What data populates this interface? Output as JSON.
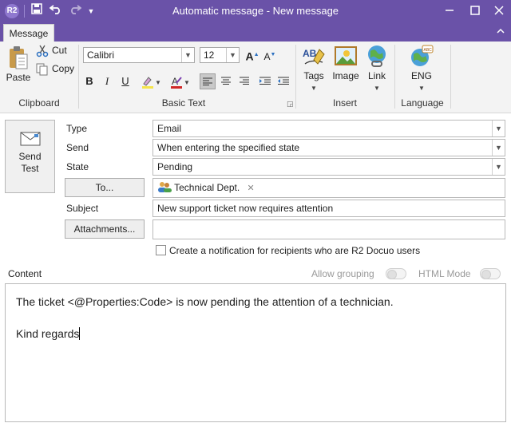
{
  "window": {
    "title": "Automatic message - New message",
    "app_icon": "R2"
  },
  "ribbon": {
    "tab": "Message",
    "clipboard": {
      "paste": "Paste",
      "cut": "Cut",
      "copy": "Copy",
      "label": "Clipboard"
    },
    "basic_text": {
      "font": "Calibri",
      "size": "12",
      "grow": "A",
      "shrink": "A",
      "bold": "B",
      "italic": "I",
      "underline": "U",
      "label": "Basic Text"
    },
    "insert": {
      "tags": "Tags",
      "image": "Image",
      "link": "Link",
      "label": "Insert"
    },
    "language": {
      "lang": "ENG",
      "label": "Language"
    }
  },
  "form": {
    "send_test": "Send\nTest",
    "type_label": "Type",
    "type_value": "Email",
    "send_label": "Send",
    "send_value": "When entering the specified state",
    "state_label": "State",
    "state_value": "Pending",
    "to_button": "To...",
    "recipient": "Technical Dept.",
    "subject_label": "Subject",
    "subject_value": "New support ticket now requires attention",
    "attachments_button": "Attachments...",
    "notify_label": "Create a notification for recipients who are R2 Docuo users",
    "content_label": "Content",
    "allow_grouping": "Allow grouping",
    "html_mode": "HTML Mode"
  },
  "content": {
    "line1": "The ticket <@Properties:Code> is now pending the attention of a technician.",
    "line2": "Kind regards"
  },
  "colors": {
    "titlebar": "#6a52a8",
    "ribbon": "#f3f3f3"
  }
}
